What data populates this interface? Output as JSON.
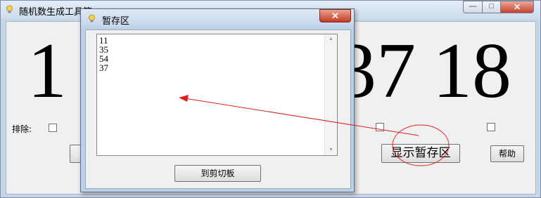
{
  "main_window": {
    "title": "随机数生成工具箱",
    "numbers": [
      "1",
      "37",
      "18"
    ],
    "exclude_label": "排除:",
    "show_temp_button": "显示暂存区",
    "help_button": "帮助",
    "caption_glyphs": {
      "minimize": "—",
      "maximize": "□",
      "close": "✕"
    }
  },
  "popup": {
    "title": "暂存区",
    "close_glyph": "✕",
    "lines": [
      "11",
      "35",
      "54",
      "37"
    ],
    "copy_button": "到剪切板",
    "scroll_up": "▲",
    "scroll_down": "▼"
  },
  "annotation": {
    "color": "#e02020"
  },
  "icons": {
    "app": "lightbulb-icon"
  }
}
